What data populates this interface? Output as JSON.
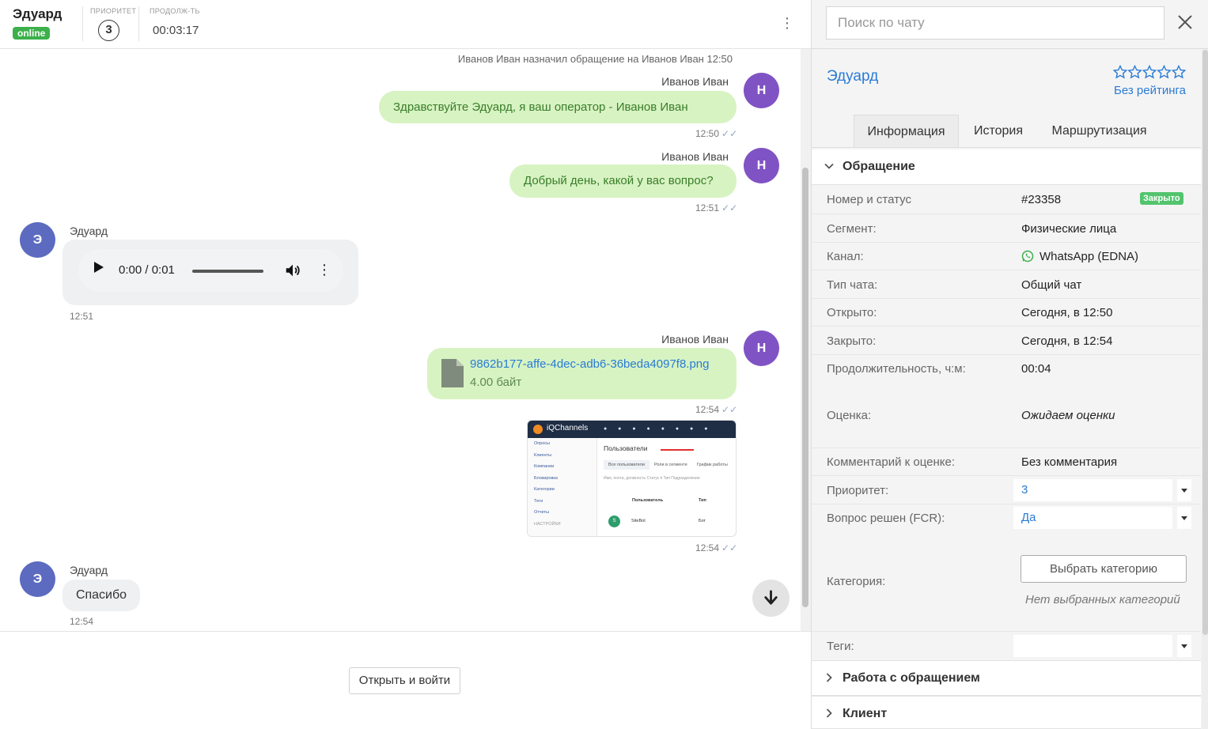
{
  "header": {
    "client_name": "Эдуард",
    "status": "online",
    "priority_label": "ПРИОРИТЕТ",
    "priority_value": "3",
    "duration_label": "ПРОДОЛЖ-ТЬ",
    "duration_value": "00:03:17"
  },
  "chat": {
    "system_message": "Иванов Иван назначил обращение на Иванов Иван 12:50",
    "messages": [
      {
        "sender": "Иванов Иван",
        "avatar": "Н",
        "text": "Здравствуйте Эдуард, я ваш оператор -  Иванов Иван",
        "time": "12:50"
      },
      {
        "sender": "Иванов Иван",
        "avatar": "Н",
        "text": "Добрый день, какой у вас вопрос?",
        "time": "12:51"
      },
      {
        "sender": "Эдуард",
        "avatar": "Э",
        "audio_time": "0:00 / 0:01",
        "time": "12:51"
      },
      {
        "sender": "Иванов Иван",
        "avatar": "Н",
        "file_name": "9862b177-affe-4dec-adb6-36beda4097f8.png",
        "file_size": "4.00 байт",
        "time": "12:54"
      },
      {
        "time": "12:54"
      },
      {
        "sender": "Эдуард",
        "avatar": "Э",
        "text": "Спасибо",
        "time": "12:54"
      }
    ],
    "ticks": "✓✓",
    "screenshot_preview": {
      "app": "iQChannels",
      "title": "Пользователи",
      "menu": [
        "Опросы",
        "Клиенты",
        "Компании",
        "Блокировка",
        "Категории",
        "Теги",
        "Отчеты",
        "НАСТРОЙКИ"
      ],
      "tabs": [
        "Все пользователи",
        "Роли в сегменте",
        "График работы"
      ],
      "filter": "Имя, почта, должность     Статус ▾     Тип     Подразделение",
      "col_user": "Пользователь",
      "col_type": "Тип",
      "row_avatar": "S",
      "row_name": "SiteBot",
      "row_type": "Бот"
    }
  },
  "footer": {
    "open_button": "Открыть и войти"
  },
  "side": {
    "search_placeholder": "Поиск по чату",
    "client_name": "Эдуард",
    "rating_label": "Без рейтинга",
    "tabs": [
      "Информация",
      "История",
      "Маршрутизация"
    ],
    "section_main": "Обращение",
    "fields": [
      {
        "key": "Номер и статус",
        "value": "#23358"
      },
      {
        "key": "Сегмент:",
        "value": "Физические лица"
      },
      {
        "key": "Канал:",
        "value": "WhatsApp (EDNA)"
      },
      {
        "key": "Тип чата:",
        "value": "Общий чат"
      },
      {
        "key": "Открыто:",
        "value": "Сегодня, в 12:50"
      },
      {
        "key": "Закрыто:",
        "value": "Сегодня, в 12:54"
      },
      {
        "key": "Продолжительность, ч:м:",
        "value": "00:04"
      },
      {
        "key": "Оценка:",
        "value": "Ожидаем оценки"
      },
      {
        "key": "Комментарий к оценке:",
        "value": "Без комментария"
      },
      {
        "key": "Приоритет:",
        "value": "3"
      },
      {
        "key": "Вопрос решен (FCR):",
        "value": "Да"
      },
      {
        "key": "Категория:",
        "value": ""
      },
      {
        "key": "Теги:",
        "value": ""
      }
    ],
    "status_badge": "Закрыто",
    "category_button": "Выбрать категорию",
    "no_categories": "Нет выбранных категорий",
    "section_work": "Работа с обращением",
    "section_client": "Клиент"
  },
  "colors": {
    "accent": "#2a7bd6",
    "online": "#3cb04a",
    "operator_avatar": "#8053c5",
    "client_avatar": "#5c6bc0",
    "outgoing_bubble": "#d7f3c2"
  }
}
